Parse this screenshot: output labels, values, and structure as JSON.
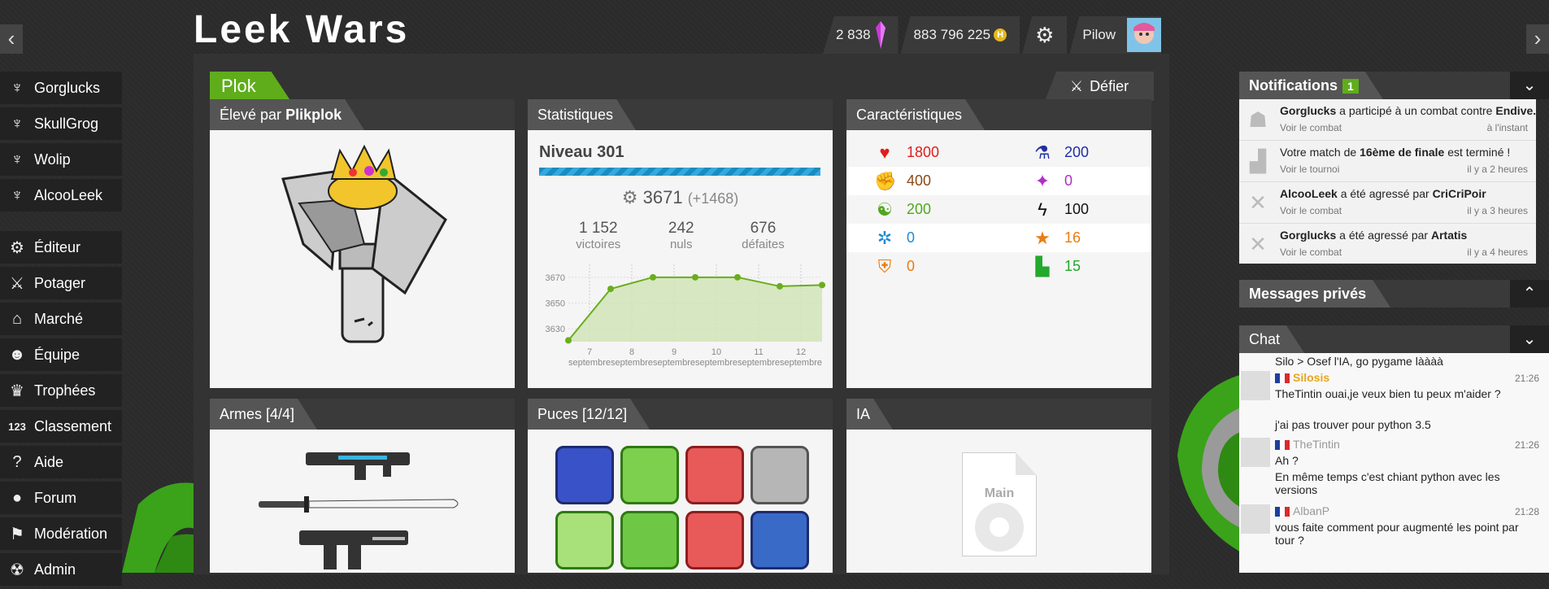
{
  "header": {
    "logo_text": "Leek Wars",
    "crystals": "2 838",
    "habs": "883 796 225",
    "username": "Pilow",
    "nav_left": "‹",
    "nav_right": "›"
  },
  "sidebar": {
    "farmers": [
      {
        "label": "Gorglucks"
      },
      {
        "label": "SkullGrog"
      },
      {
        "label": "Wolip"
      },
      {
        "label": "AlcooLeek"
      }
    ],
    "menu": [
      {
        "label": "Éditeur",
        "icon": "gear-icon"
      },
      {
        "label": "Potager",
        "icon": "sword-icon"
      },
      {
        "label": "Marché",
        "icon": "market-icon"
      },
      {
        "label": "Équipe",
        "icon": "team-icon"
      },
      {
        "label": "Trophées",
        "icon": "trophy-icon"
      },
      {
        "label": "Classement",
        "icon": "ranking-icon"
      },
      {
        "label": "Aide",
        "icon": "help-icon"
      },
      {
        "label": "Forum",
        "icon": "forum-icon"
      },
      {
        "label": "Modération",
        "icon": "flag-icon"
      },
      {
        "label": "Admin",
        "icon": "admin-icon"
      }
    ]
  },
  "leek": {
    "name": "Plok",
    "challenge": "Défier",
    "raised_by_prefix": "Élevé par",
    "raised_by": "Plikplok"
  },
  "stats": {
    "title": "Statistiques",
    "level": "Niveau 301",
    "talent": "3671",
    "talent_delta": "(+1468)",
    "victories": "1 152",
    "victories_label": "victoires",
    "draws": "242",
    "draws_label": "nuls",
    "defeats": "676",
    "defeats_label": "défaites"
  },
  "chart_data": {
    "type": "area",
    "title": "",
    "xlabel": "",
    "ylabel": "",
    "x": [
      "7 septembre",
      "8 septembre",
      "9 septembre",
      "10 septembre",
      "11 septembre",
      "12 septembre"
    ],
    "yticks": [
      "3670",
      "3650",
      "3630"
    ],
    "ylim": [
      3620,
      3680
    ],
    "series": [
      {
        "points": [
          [
            6.5,
            3621
          ],
          [
            7.5,
            3661
          ],
          [
            8.5,
            3670
          ],
          [
            9.5,
            3670
          ],
          [
            10.5,
            3670
          ],
          [
            11.5,
            3663
          ],
          [
            12.5,
            3664
          ]
        ]
      }
    ],
    "colors": {
      "line": "#6aad1e",
      "fill": "#cfe3b4"
    },
    "grid": true
  },
  "characteristics": {
    "title": "Caractéristiques",
    "left": [
      {
        "value": "1800",
        "icon": "heart-icon",
        "color": "#e01d1d"
      },
      {
        "value": "400",
        "icon": "strength-icon",
        "color": "#8a4a18"
      },
      {
        "value": "200",
        "icon": "wisdom-icon",
        "color": "#4fa81e"
      },
      {
        "value": "0",
        "icon": "agility-icon",
        "color": "#1c8bd6"
      },
      {
        "value": "0",
        "icon": "resistance-icon",
        "color": "#ea7c12"
      }
    ],
    "right": [
      {
        "value": "200",
        "icon": "science-icon",
        "color": "#1f2fa0"
      },
      {
        "value": "0",
        "icon": "magic-icon",
        "color": "#b02fc9"
      },
      {
        "value": "100",
        "icon": "frequency-icon",
        "color": "#111111"
      },
      {
        "value": "16",
        "icon": "tp-icon",
        "color": "#ea7c12"
      },
      {
        "value": "15",
        "icon": "mp-icon",
        "color": "#24a82e"
      }
    ]
  },
  "weapons": {
    "title": "Armes [4/4]"
  },
  "chips": {
    "title": "Puces [12/12]"
  },
  "ai": {
    "title": "IA",
    "name": "Main"
  },
  "notifications": {
    "title": "Notifications",
    "count": "1",
    "items": [
      {
        "bold": "Gorglucks",
        "text": " a participé à un combat contre ",
        "bold2": "Endive...",
        "sub": "Voir le combat",
        "date": "à l'instant",
        "icon": "fight-icon"
      },
      {
        "text": "Votre match de ",
        "bold": "16ème de finale",
        "text2": " est terminé !",
        "sub": "Voir le tournoi",
        "date": "il y a 2 heures",
        "icon": "tournament-icon"
      },
      {
        "bold": "AlcooLeek",
        "text": " a été agressé par ",
        "bold2": "CriCriPoir",
        "sub": "Voir le combat",
        "date": "il y a 3 heures",
        "icon": "swords-icon"
      },
      {
        "bold": "Gorglucks",
        "text": " a été agressé par ",
        "bold2": "Artatis",
        "sub": "Voir le combat",
        "date": "il y a 4 heures",
        "icon": "swords-icon"
      }
    ]
  },
  "messages": {
    "title": "Messages privés"
  },
  "chat": {
    "title": "Chat",
    "first_line": "Silo > Osef l'IA, go pygame làààà",
    "messages": [
      {
        "author": "Silosis",
        "time": "21:26",
        "lines": [
          "TheTintin ouai,je veux bien tu peux m'aider ?",
          "j'ai pas trouver pour python 3.5"
        ]
      },
      {
        "author": "TheTintin",
        "time": "21:26",
        "lines": [
          "Ah ?",
          "En même temps c'est chiant python avec les versions"
        ]
      },
      {
        "author": "AlbanP",
        "time": "21:28",
        "lines": [
          "vous faite comment pour augmenté les point par tour ?"
        ]
      }
    ]
  }
}
